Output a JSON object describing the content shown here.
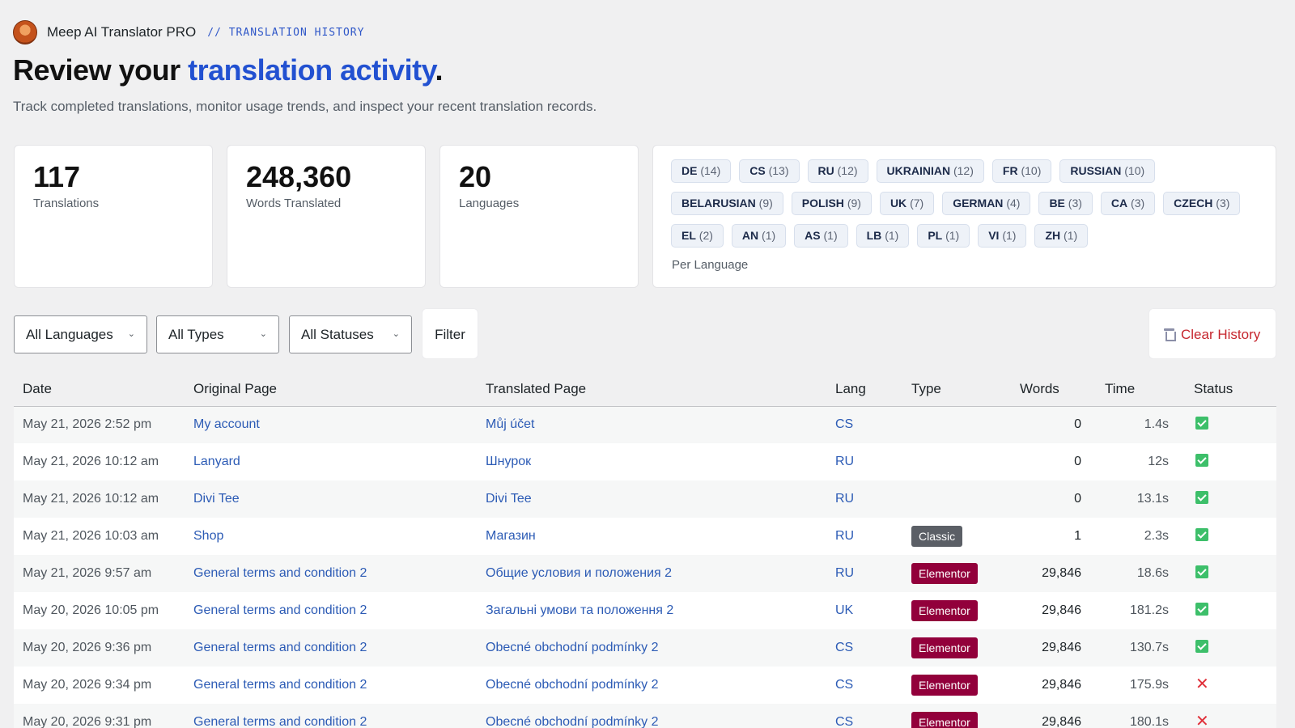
{
  "header": {
    "app_name": "Meep AI Translator PRO",
    "breadcrumb": "// TRANSLATION HISTORY",
    "title_prefix": "Review your ",
    "title_accent": "translation activity",
    "title_suffix": ".",
    "subtitle": "Track completed translations, monitor usage trends, and inspect your recent translation records."
  },
  "stats": {
    "translations": {
      "value": "117",
      "label": "Translations"
    },
    "words": {
      "value": "248,360",
      "label": "Words Translated"
    },
    "languages": {
      "value": "20",
      "label": "Languages"
    }
  },
  "per_language": {
    "label": "Per Language",
    "chips": [
      {
        "code": "DE",
        "count": "(14)"
      },
      {
        "code": "CS",
        "count": "(13)"
      },
      {
        "code": "RU",
        "count": "(12)"
      },
      {
        "code": "UKRAINIAN",
        "count": "(12)"
      },
      {
        "code": "FR",
        "count": "(10)"
      },
      {
        "code": "RUSSIAN",
        "count": "(10)"
      },
      {
        "code": "BELARUSIAN",
        "count": "(9)"
      },
      {
        "code": "POLISH",
        "count": "(9)"
      },
      {
        "code": "UK",
        "count": "(7)"
      },
      {
        "code": "GERMAN",
        "count": "(4)"
      },
      {
        "code": "BE",
        "count": "(3)"
      },
      {
        "code": "CA",
        "count": "(3)"
      },
      {
        "code": "CZECH",
        "count": "(3)"
      },
      {
        "code": "EL",
        "count": "(2)"
      },
      {
        "code": "AN",
        "count": "(1)"
      },
      {
        "code": "AS",
        "count": "(1)"
      },
      {
        "code": "LB",
        "count": "(1)"
      },
      {
        "code": "PL",
        "count": "(1)"
      },
      {
        "code": "VI",
        "count": "(1)"
      },
      {
        "code": "ZH",
        "count": "(1)"
      }
    ]
  },
  "filters": {
    "language": "All Languages",
    "type": "All Types",
    "status": "All Statuses",
    "filter_button": "Filter",
    "clear_button": "Clear History"
  },
  "table": {
    "columns": [
      "Date",
      "Original Page",
      "Translated Page",
      "Lang",
      "Type",
      "Words",
      "Time",
      "Status"
    ],
    "rows": [
      {
        "date": "May 21, 2026 2:52 pm",
        "original": "My account",
        "translated": "Můj účet",
        "lang": "CS",
        "type": "",
        "type_style": "blank",
        "words": "0",
        "time": "1.4s",
        "status": "success"
      },
      {
        "date": "May 21, 2026 10:12 am",
        "original": "Lanyard",
        "translated": "Шнурок",
        "lang": "RU",
        "type": "",
        "type_style": "blank",
        "words": "0",
        "time": "12s",
        "status": "success"
      },
      {
        "date": "May 21, 2026 10:12 am",
        "original": "Divi Tee",
        "translated": "Divi Tee",
        "lang": "RU",
        "type": "",
        "type_style": "blank",
        "words": "0",
        "time": "13.1s",
        "status": "success"
      },
      {
        "date": "May 21, 2026 10:03 am",
        "original": "Shop",
        "translated": "Магазин",
        "lang": "RU",
        "type": "Classic",
        "type_style": "classic",
        "words": "1",
        "time": "2.3s",
        "status": "success"
      },
      {
        "date": "May 21, 2026 9:57 am",
        "original": "General terms and condition 2",
        "translated": "Общие условия и положения 2",
        "lang": "RU",
        "type": "Elementor",
        "type_style": "elementor",
        "words": "29,846",
        "time": "18.6s",
        "status": "success"
      },
      {
        "date": "May 20, 2026 10:05 pm",
        "original": "General terms and condition 2",
        "translated": "Загальні умови та положення 2",
        "lang": "UK",
        "type": "Elementor",
        "type_style": "elementor",
        "words": "29,846",
        "time": "181.2s",
        "status": "success"
      },
      {
        "date": "May 20, 2026 9:36 pm",
        "original": "General terms and condition 2",
        "translated": "Obecné obchodní podmínky 2",
        "lang": "CS",
        "type": "Elementor",
        "type_style": "elementor",
        "words": "29,846",
        "time": "130.7s",
        "status": "success"
      },
      {
        "date": "May 20, 2026 9:34 pm",
        "original": "General terms and condition 2",
        "translated": "Obecné obchodní podmínky 2",
        "lang": "CS",
        "type": "Elementor",
        "type_style": "elementor",
        "words": "29,846",
        "time": "175.9s",
        "status": "failed"
      },
      {
        "date": "May 20, 2026 9:31 pm",
        "original": "General terms and condition 2",
        "translated": "Obecné obchodní podmínky 2",
        "lang": "CS",
        "type": "Elementor",
        "type_style": "elementor",
        "words": "29,846",
        "time": "180.1s",
        "status": "failed"
      }
    ]
  },
  "icons": {
    "logo": "avatar-logo",
    "dropdown": "chevron-down-icon",
    "clear": "trash-icon",
    "success": "checkmark-icon",
    "failed": "x-icon"
  },
  "colors": {
    "accent": "#2251d1",
    "link": "#2c5bb5",
    "danger": "#c6262e",
    "success": "#3dbf6a",
    "elementor": "#92003b",
    "classic": "#5b5f66"
  }
}
